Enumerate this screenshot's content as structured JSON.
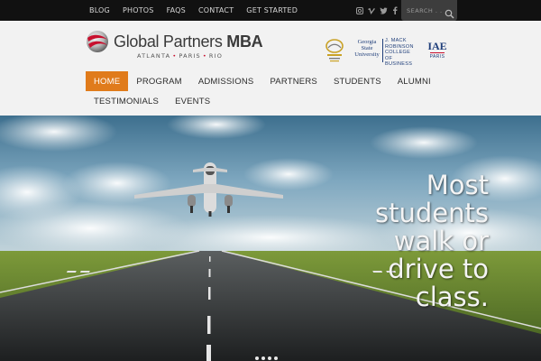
{
  "topnav": {
    "items": [
      {
        "label": "BLOG"
      },
      {
        "label": "PHOTOS"
      },
      {
        "label": "FAQS"
      },
      {
        "label": "CONTACT"
      },
      {
        "label": "GET STARTED"
      }
    ]
  },
  "social": [
    "instagram-icon",
    "vimeo-icon",
    "twitter-icon",
    "facebook-icon"
  ],
  "search": {
    "placeholder": "SEARCH . . ."
  },
  "logo": {
    "name_regular": "Global Partners ",
    "name_bold": "MBA",
    "cities": [
      "ATLANTA",
      "PARIS",
      "RIO"
    ]
  },
  "partners": {
    "gsu_name": [
      "Georgia State",
      "University"
    ],
    "robinson": [
      "J. MACK",
      "ROBINSON",
      "COLLEGE",
      "OF BUSINESS"
    ],
    "iae": {
      "mark": "IAE",
      "city": "PARIS"
    }
  },
  "mainnav": {
    "row1": [
      {
        "label": "HOME",
        "active": true
      },
      {
        "label": "PROGRAM"
      },
      {
        "label": "ADMISSIONS"
      },
      {
        "label": "PARTNERS"
      },
      {
        "label": "STUDENTS"
      },
      {
        "label": "ALUMNI"
      }
    ],
    "row2": [
      {
        "label": "TESTIMONIALS"
      },
      {
        "label": "EVENTS"
      }
    ]
  },
  "hero": {
    "lines": [
      "Most",
      "students",
      "walk or",
      "drive to",
      "class."
    ],
    "slide_count": 4
  },
  "colors": {
    "accent": "#e07b1b",
    "brand_red": "#c8102e",
    "topbar": "#111111",
    "header_bg": "#f2f2f2"
  }
}
